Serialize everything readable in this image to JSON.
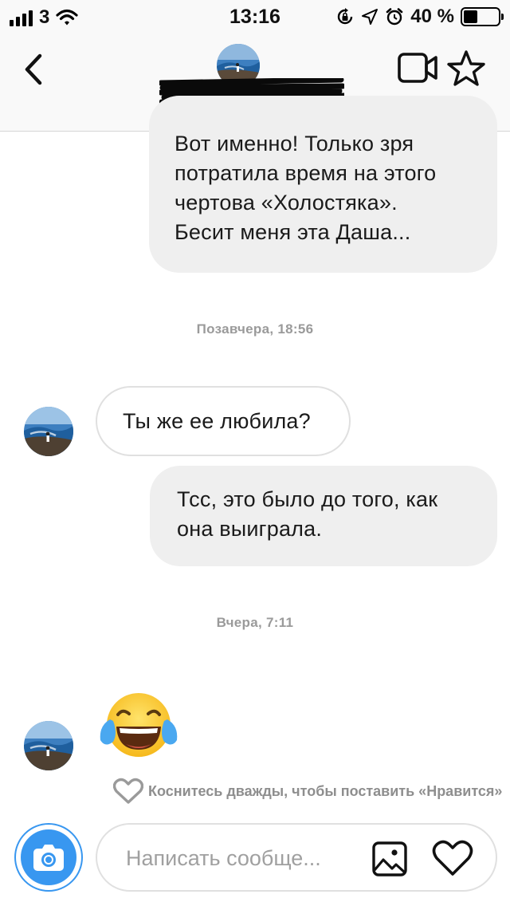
{
  "status_bar": {
    "carrier": "3",
    "time": "13:16",
    "battery_percent": "40 %",
    "battery_level": 0.4
  },
  "header": {
    "back_icon": "chevron-left-icon",
    "video_icon": "video-camera-icon",
    "star_icon": "star-icon"
  },
  "messages": {
    "msg1_lines": [
      "Вот именно! Только зря",
      "потратила время на этого",
      "чертова «Холостяка».",
      "Бесит меня эта Даша..."
    ],
    "timestamp1": "Позавчера, 18:56",
    "msg2": "Ты же ее любила?",
    "msg3_lines": [
      "Тсс, это было до того, как",
      "она выиграла."
    ],
    "timestamp2": "Вчера, 7:11",
    "emoji_name": "face-with-tears-of-joy",
    "like_hint": "Коснитесь дважды, чтобы поставить «Нравится»"
  },
  "composer": {
    "placeholder": "Написать сообще...",
    "camera_icon": "camera-icon",
    "gallery_icon": "image-icon",
    "heart_icon": "heart-icon"
  },
  "colors": {
    "accent": "#3897f0",
    "bubble_out": "#efefef",
    "bubble_in_border": "#e0e0e0",
    "timestamp": "#9a9a9a"
  }
}
